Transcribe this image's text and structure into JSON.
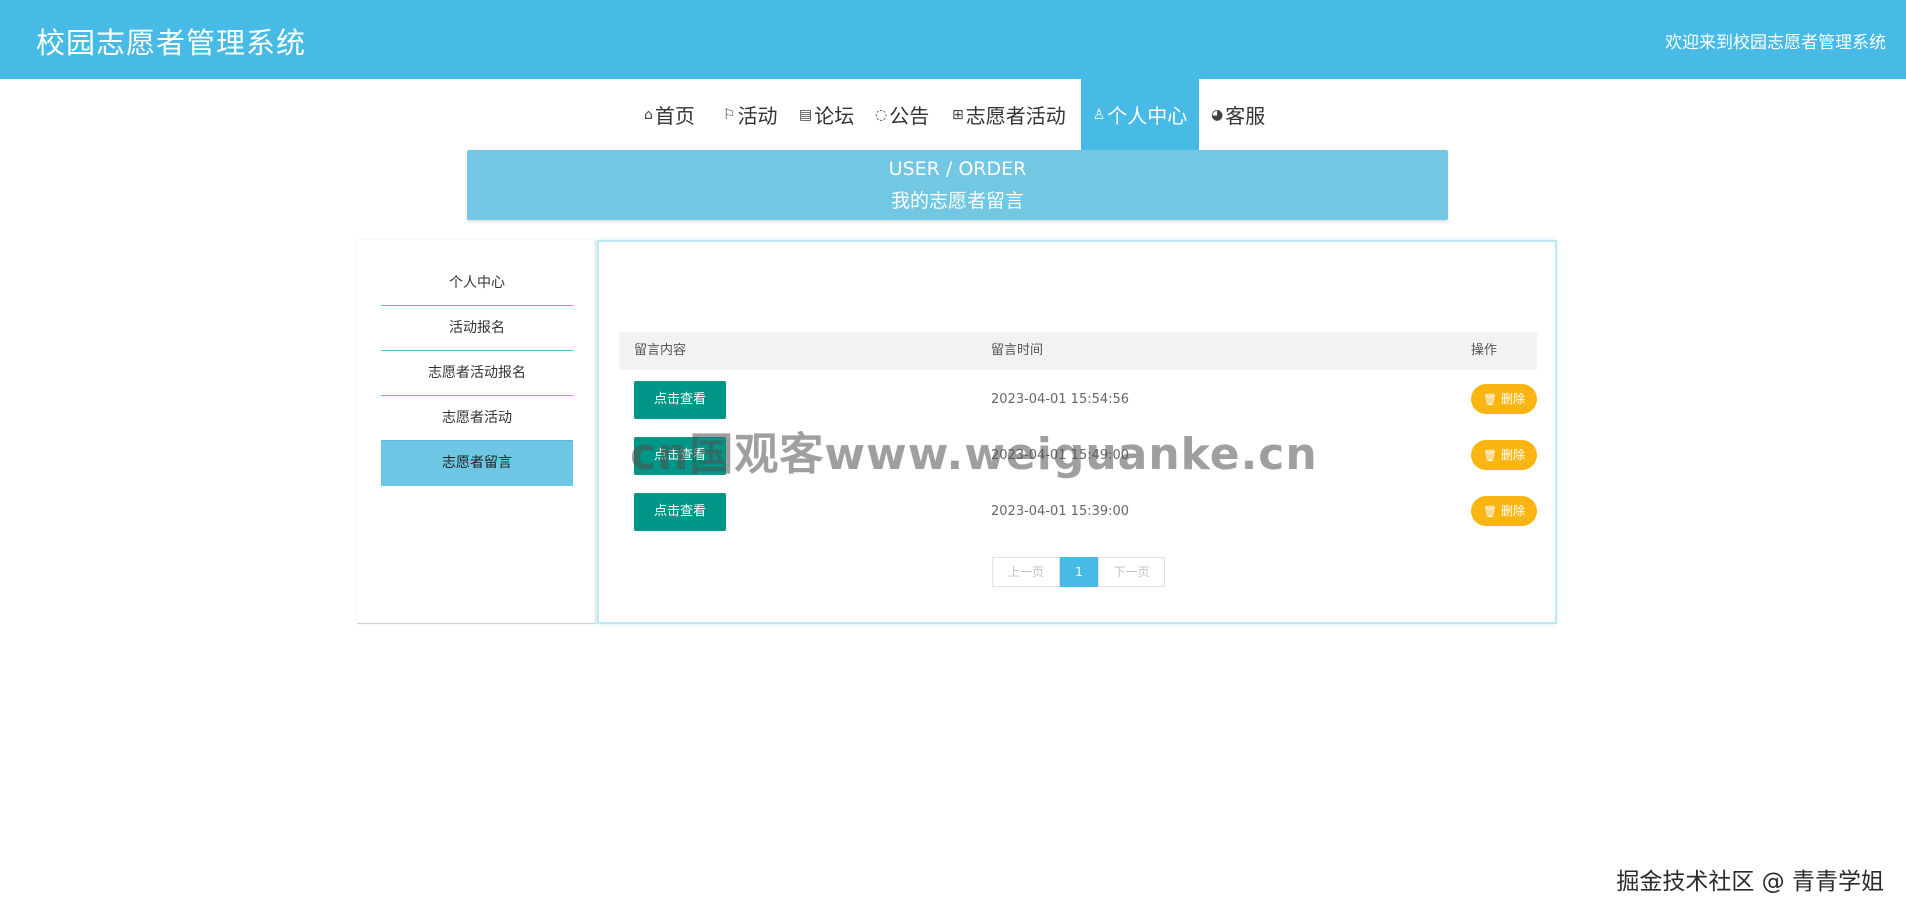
{
  "header": {
    "site_title": "校园志愿者管理系统",
    "welcome": "欢迎来到校园志愿者管理系统"
  },
  "nav": {
    "items": [
      {
        "icon": "home-icon",
        "glyph": "⌂",
        "label": "首页"
      },
      {
        "icon": "flag-icon",
        "glyph": "⚐",
        "label": "活动"
      },
      {
        "icon": "forum-icon",
        "glyph": "▤",
        "label": "论坛"
      },
      {
        "icon": "notice-icon",
        "glyph": "◌",
        "label": "公告"
      },
      {
        "icon": "gift-icon",
        "glyph": "⊞",
        "label": "志愿者活动"
      },
      {
        "icon": "user-icon",
        "glyph": "♙",
        "label": "个人中心"
      },
      {
        "icon": "service-icon",
        "glyph": "◕",
        "label": "客服"
      }
    ],
    "active": "个人中心"
  },
  "banner": {
    "en": "USER / ORDER",
    "cn": "我的志愿者留言"
  },
  "sidebar": {
    "items": [
      {
        "label": "个人中心"
      },
      {
        "label": "活动报名"
      },
      {
        "label": "志愿者活动报名"
      },
      {
        "label": "志愿者活动"
      },
      {
        "label": "志愿者留言"
      }
    ],
    "active": "志愿者留言"
  },
  "table": {
    "headers": [
      "留言内容",
      "留言时间",
      "操作"
    ],
    "rows": [
      {
        "view_label": "点击查看",
        "time": "2023-04-01 15:54:56",
        "delete_label": "删除"
      },
      {
        "view_label": "点击查看",
        "time": "2023-04-01 15:49:00",
        "delete_label": "删除"
      },
      {
        "view_label": "点击查看",
        "time": "2023-04-01 15:39:00",
        "delete_label": "删除"
      }
    ]
  },
  "pagination": {
    "prev": "上一页",
    "current": "1",
    "next": "下一页"
  },
  "overlays": {
    "watermark": "cn国观客www.weiguanke.cn",
    "credit": "掘金技术社区 @ 青青学姐"
  },
  "colors": {
    "primary": "#47bbe6",
    "banner": "#72c7e3",
    "view_button": "#009688",
    "delete_button": "#fbb513"
  }
}
